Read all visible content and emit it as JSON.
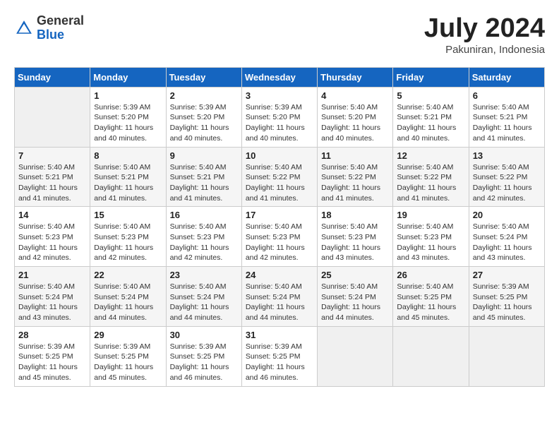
{
  "header": {
    "logo_general": "General",
    "logo_blue": "Blue",
    "month_year": "July 2024",
    "location": "Pakuniran, Indonesia"
  },
  "days_of_week": [
    "Sunday",
    "Monday",
    "Tuesday",
    "Wednesday",
    "Thursday",
    "Friday",
    "Saturday"
  ],
  "weeks": [
    [
      {
        "num": "",
        "empty": true
      },
      {
        "num": "1",
        "sunrise": "5:39 AM",
        "sunset": "5:20 PM",
        "daylight": "11 hours and 40 minutes."
      },
      {
        "num": "2",
        "sunrise": "5:39 AM",
        "sunset": "5:20 PM",
        "daylight": "11 hours and 40 minutes."
      },
      {
        "num": "3",
        "sunrise": "5:39 AM",
        "sunset": "5:20 PM",
        "daylight": "11 hours and 40 minutes."
      },
      {
        "num": "4",
        "sunrise": "5:40 AM",
        "sunset": "5:20 PM",
        "daylight": "11 hours and 40 minutes."
      },
      {
        "num": "5",
        "sunrise": "5:40 AM",
        "sunset": "5:21 PM",
        "daylight": "11 hours and 40 minutes."
      },
      {
        "num": "6",
        "sunrise": "5:40 AM",
        "sunset": "5:21 PM",
        "daylight": "11 hours and 41 minutes."
      }
    ],
    [
      {
        "num": "7",
        "sunrise": "5:40 AM",
        "sunset": "5:21 PM",
        "daylight": "11 hours and 41 minutes."
      },
      {
        "num": "8",
        "sunrise": "5:40 AM",
        "sunset": "5:21 PM",
        "daylight": "11 hours and 41 minutes."
      },
      {
        "num": "9",
        "sunrise": "5:40 AM",
        "sunset": "5:21 PM",
        "daylight": "11 hours and 41 minutes."
      },
      {
        "num": "10",
        "sunrise": "5:40 AM",
        "sunset": "5:22 PM",
        "daylight": "11 hours and 41 minutes."
      },
      {
        "num": "11",
        "sunrise": "5:40 AM",
        "sunset": "5:22 PM",
        "daylight": "11 hours and 41 minutes."
      },
      {
        "num": "12",
        "sunrise": "5:40 AM",
        "sunset": "5:22 PM",
        "daylight": "11 hours and 41 minutes."
      },
      {
        "num": "13",
        "sunrise": "5:40 AM",
        "sunset": "5:22 PM",
        "daylight": "11 hours and 42 minutes."
      }
    ],
    [
      {
        "num": "14",
        "sunrise": "5:40 AM",
        "sunset": "5:23 PM",
        "daylight": "11 hours and 42 minutes."
      },
      {
        "num": "15",
        "sunrise": "5:40 AM",
        "sunset": "5:23 PM",
        "daylight": "11 hours and 42 minutes."
      },
      {
        "num": "16",
        "sunrise": "5:40 AM",
        "sunset": "5:23 PM",
        "daylight": "11 hours and 42 minutes."
      },
      {
        "num": "17",
        "sunrise": "5:40 AM",
        "sunset": "5:23 PM",
        "daylight": "11 hours and 42 minutes."
      },
      {
        "num": "18",
        "sunrise": "5:40 AM",
        "sunset": "5:23 PM",
        "daylight": "11 hours and 43 minutes."
      },
      {
        "num": "19",
        "sunrise": "5:40 AM",
        "sunset": "5:23 PM",
        "daylight": "11 hours and 43 minutes."
      },
      {
        "num": "20",
        "sunrise": "5:40 AM",
        "sunset": "5:24 PM",
        "daylight": "11 hours and 43 minutes."
      }
    ],
    [
      {
        "num": "21",
        "sunrise": "5:40 AM",
        "sunset": "5:24 PM",
        "daylight": "11 hours and 43 minutes."
      },
      {
        "num": "22",
        "sunrise": "5:40 AM",
        "sunset": "5:24 PM",
        "daylight": "11 hours and 44 minutes."
      },
      {
        "num": "23",
        "sunrise": "5:40 AM",
        "sunset": "5:24 PM",
        "daylight": "11 hours and 44 minutes."
      },
      {
        "num": "24",
        "sunrise": "5:40 AM",
        "sunset": "5:24 PM",
        "daylight": "11 hours and 44 minutes."
      },
      {
        "num": "25",
        "sunrise": "5:40 AM",
        "sunset": "5:24 PM",
        "daylight": "11 hours and 44 minutes."
      },
      {
        "num": "26",
        "sunrise": "5:40 AM",
        "sunset": "5:25 PM",
        "daylight": "11 hours and 45 minutes."
      },
      {
        "num": "27",
        "sunrise": "5:39 AM",
        "sunset": "5:25 PM",
        "daylight": "11 hours and 45 minutes."
      }
    ],
    [
      {
        "num": "28",
        "sunrise": "5:39 AM",
        "sunset": "5:25 PM",
        "daylight": "11 hours and 45 minutes."
      },
      {
        "num": "29",
        "sunrise": "5:39 AM",
        "sunset": "5:25 PM",
        "daylight": "11 hours and 45 minutes."
      },
      {
        "num": "30",
        "sunrise": "5:39 AM",
        "sunset": "5:25 PM",
        "daylight": "11 hours and 46 minutes."
      },
      {
        "num": "31",
        "sunrise": "5:39 AM",
        "sunset": "5:25 PM",
        "daylight": "11 hours and 46 minutes."
      },
      {
        "num": "",
        "empty": true
      },
      {
        "num": "",
        "empty": true
      },
      {
        "num": "",
        "empty": true
      }
    ]
  ],
  "labels": {
    "sunrise_prefix": "Sunrise: ",
    "sunset_prefix": "Sunset: ",
    "daylight_prefix": "Daylight: "
  }
}
